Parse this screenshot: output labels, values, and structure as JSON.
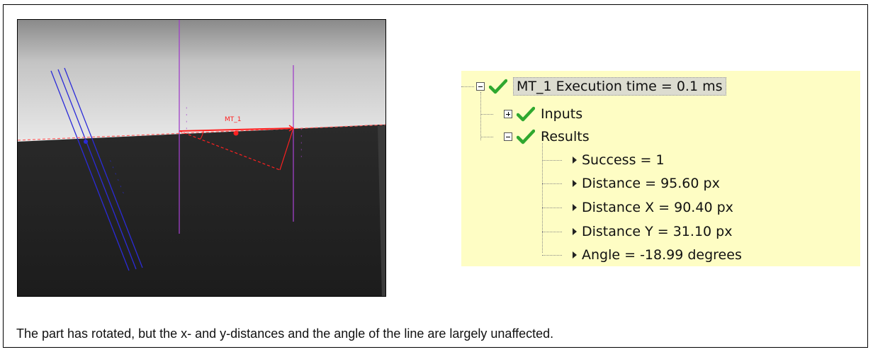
{
  "tree": {
    "root": {
      "label": "MT_1 Execution time = 0.1 ms",
      "expanded": true,
      "status": "success"
    },
    "children": [
      {
        "label": "Inputs",
        "expanded": false,
        "status": "success"
      },
      {
        "label": "Results",
        "expanded": true,
        "status": "success"
      }
    ],
    "results": [
      {
        "label": "Success = 1"
      },
      {
        "label": "Distance = 95.60 px"
      },
      {
        "label": "Distance X = 90.40 px"
      },
      {
        "label": "Distance Y = 31.10 px"
      },
      {
        "label": "Angle = -18.99 degrees"
      }
    ]
  },
  "image": {
    "overlay_label": "MT_1"
  },
  "caption": "The part has rotated, but the x- and y-distances and the angle of the line are largely unaffected.",
  "colors": {
    "panel_bg": "#fefdc4",
    "check_green": "#2fa82f",
    "measure_red": "#ff2020",
    "scan_blue": "#2b2bd8",
    "scan_purple": "#a040c8"
  }
}
